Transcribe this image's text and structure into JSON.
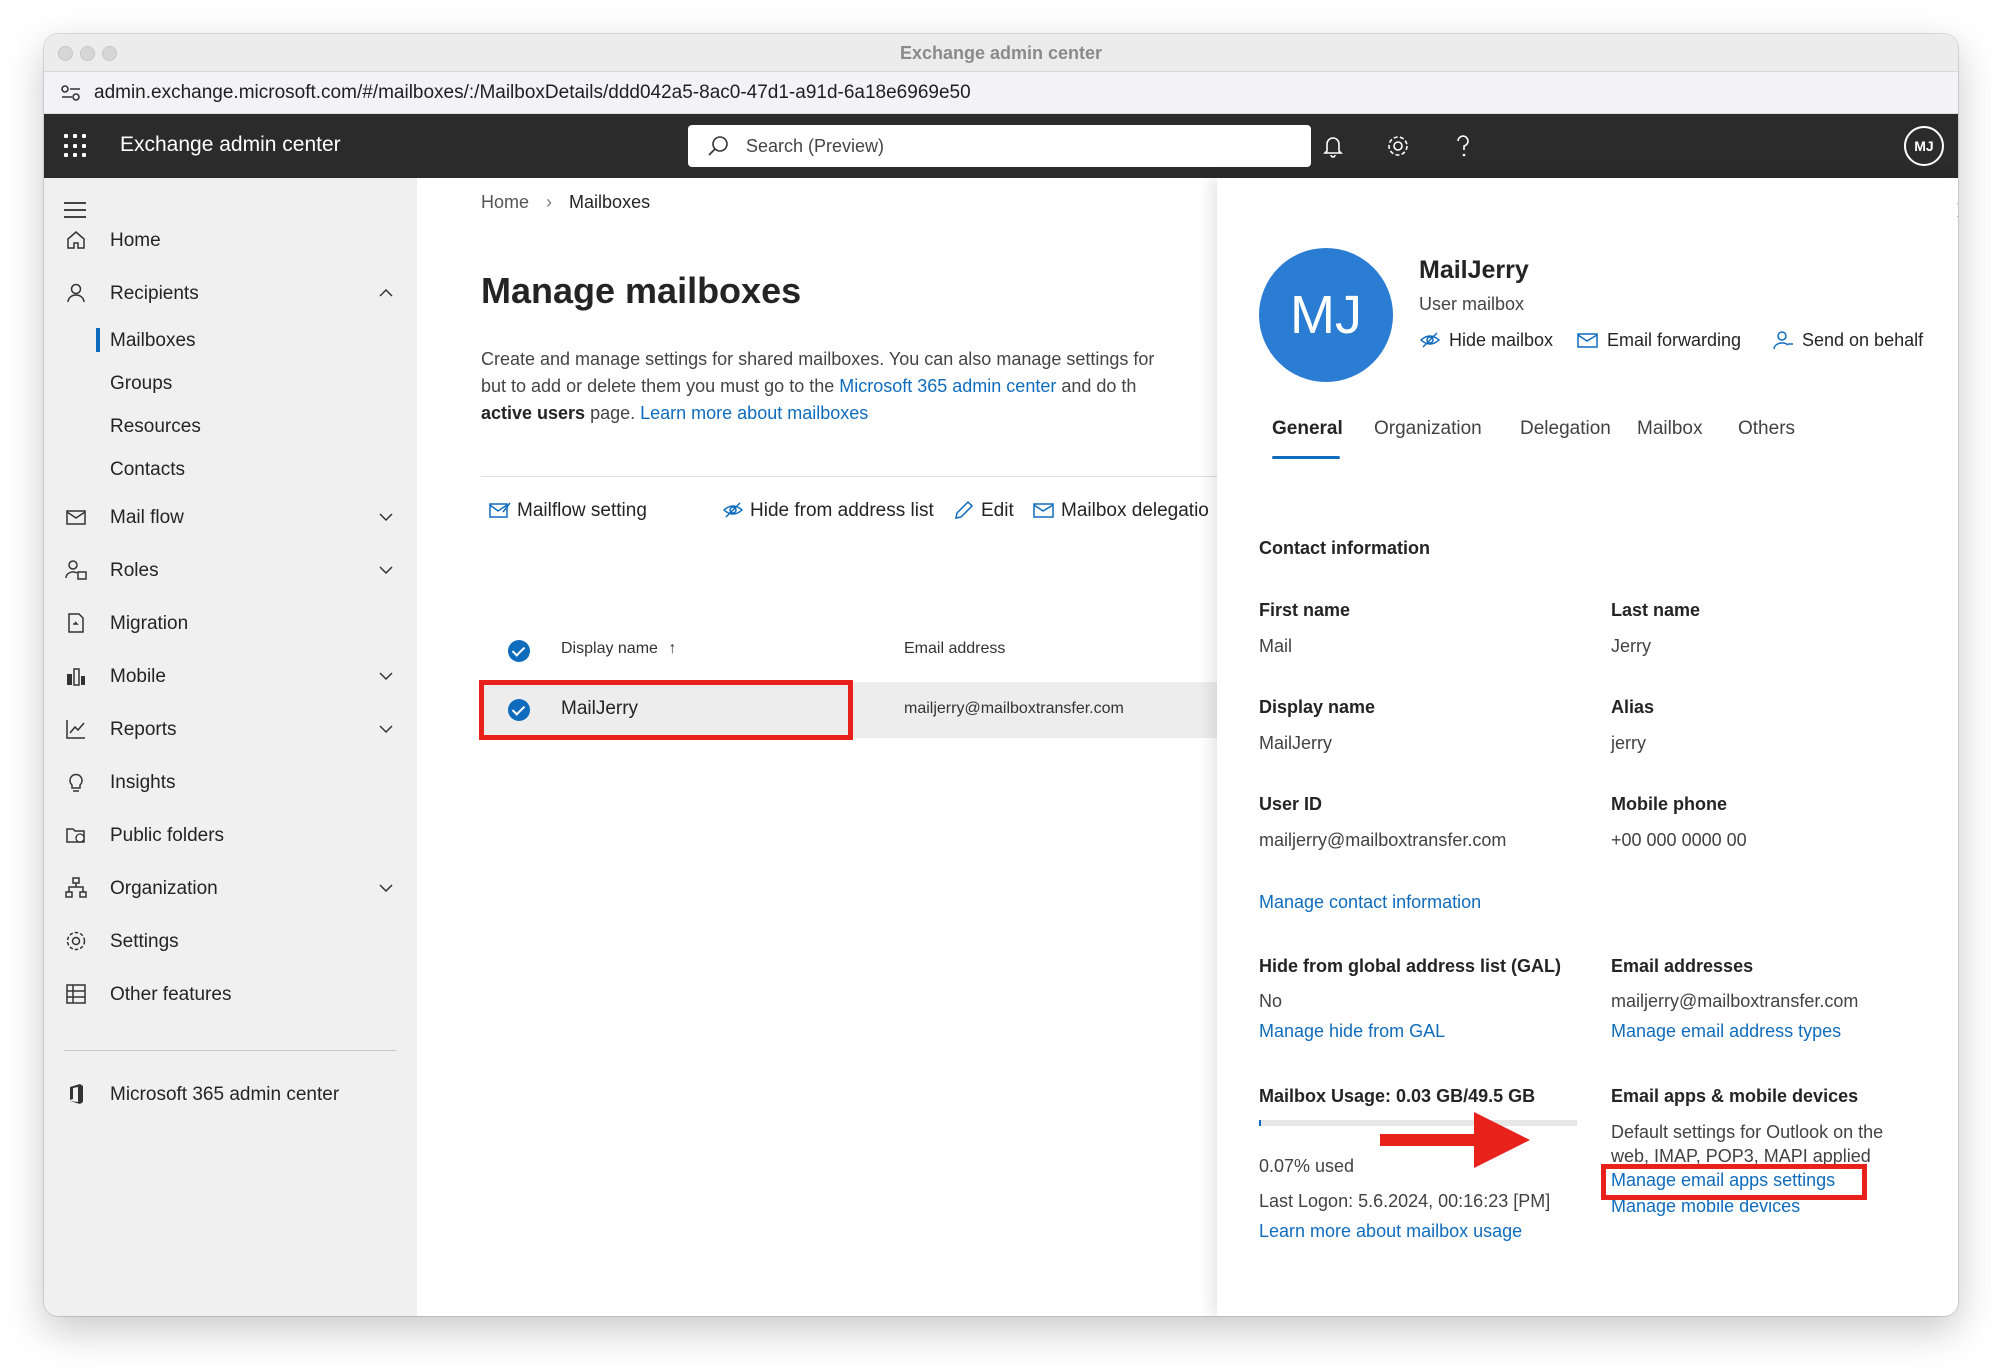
{
  "window": {
    "title": "Exchange admin center"
  },
  "browser": {
    "url": "admin.exchange.microsoft.com/#/mailboxes/:/MailboxDetails/ddd042a5-8ac0-47d1-a91d-6a18e6969e50"
  },
  "header": {
    "app_title": "Exchange admin center",
    "search_placeholder": "Search (Preview)",
    "icons": [
      "terminal-icon",
      "bell-icon",
      "gear-icon",
      "help-icon"
    ],
    "avatar_initials": "MJ"
  },
  "sidebar": {
    "items": [
      {
        "label": "Home",
        "icon": "home-icon"
      },
      {
        "label": "Recipients",
        "icon": "person-icon",
        "expanded": true
      },
      {
        "label": "Mailboxes",
        "sub": true,
        "selected": true
      },
      {
        "label": "Groups",
        "sub": true
      },
      {
        "label": "Resources",
        "sub": true
      },
      {
        "label": "Contacts",
        "sub": true
      },
      {
        "label": "Mail flow",
        "icon": "mail-icon"
      },
      {
        "label": "Roles",
        "icon": "roles-icon"
      },
      {
        "label": "Migration",
        "icon": "migration-icon"
      },
      {
        "label": "Mobile",
        "icon": "mobile-icon"
      },
      {
        "label": "Reports",
        "icon": "chart-icon"
      },
      {
        "label": "Insights",
        "icon": "lightbulb-icon"
      },
      {
        "label": "Public folders",
        "icon": "folder-icon"
      },
      {
        "label": "Organization",
        "icon": "org-icon"
      },
      {
        "label": "Settings",
        "icon": "settings-icon"
      },
      {
        "label": "Other features",
        "icon": "table-icon"
      },
      {
        "label": "Microsoft 365 admin center",
        "icon": "office-icon"
      }
    ]
  },
  "main": {
    "breadcrumb": [
      "Home",
      "Mailboxes"
    ],
    "title": "Manage mailboxes",
    "desc_line1": "Create and manage settings for shared mailboxes. You can also manage settings for",
    "desc_line2_a": "but to add or delete them you must go to the ",
    "desc_line2_link": "Microsoft 365 admin center",
    "desc_line2_b": " and do th",
    "desc_line3_bold": "active users",
    "desc_line3_a": " page. ",
    "desc_line3_link": "Learn more about mailboxes",
    "commands": [
      "Mailflow setting",
      "Hide from address list",
      "Edit",
      "Mailbox delegatio"
    ],
    "table": {
      "headers": [
        "Display name",
        "Email address"
      ],
      "sort_indicator": "↑",
      "rows": [
        {
          "name": "MailJerry",
          "email": "mailjerry@mailboxtransfer.com",
          "selected": true
        }
      ]
    }
  },
  "panel": {
    "avatar_initials": "MJ",
    "name": "MailJerry",
    "type": "User mailbox",
    "actions": [
      "Hide mailbox",
      "Email forwarding",
      "Send on behalf"
    ],
    "tabs": [
      "General",
      "Organization",
      "Delegation",
      "Mailbox",
      "Others"
    ],
    "active_tab": "General",
    "contact_header": "Contact information",
    "first_name_label": "First name",
    "first_name": "Mail",
    "last_name_label": "Last name",
    "last_name": "Jerry",
    "display_name_label": "Display name",
    "display_name": "MailJerry",
    "alias_label": "Alias",
    "alias": "jerry",
    "user_id_label": "User ID",
    "user_id": "mailjerry@mailboxtransfer.com",
    "mobile_label": "Mobile phone",
    "mobile": "+00 000 0000 00",
    "manage_contact": "Manage contact information",
    "gal_label": "Hide from global address list (GAL)",
    "gal_value": "No",
    "gal_link": "Manage hide from GAL",
    "email_addr_label": "Email addresses",
    "email_addr": "mailjerry@mailboxtransfer.com",
    "email_addr_link": "Manage email address types",
    "usage_label": "Mailbox Usage: 0.03 GB/49.5 GB",
    "usage_fraction": 0.0007,
    "usage_pct": "0.07% used",
    "last_logon": "Last Logon: 5.6.2024, 00:16:23 [PM]",
    "usage_link": "Learn more about mailbox usage",
    "apps_label": "Email apps & mobile devices",
    "apps_desc_1": "Default settings for Outlook on the",
    "apps_desc_2": "web, IMAP, POP3, MAPI applied",
    "apps_link": "Manage email apps settings",
    "mobile_link": "Manage mobile devices"
  },
  "annotation": {
    "highlight_color": "#e8211b"
  }
}
